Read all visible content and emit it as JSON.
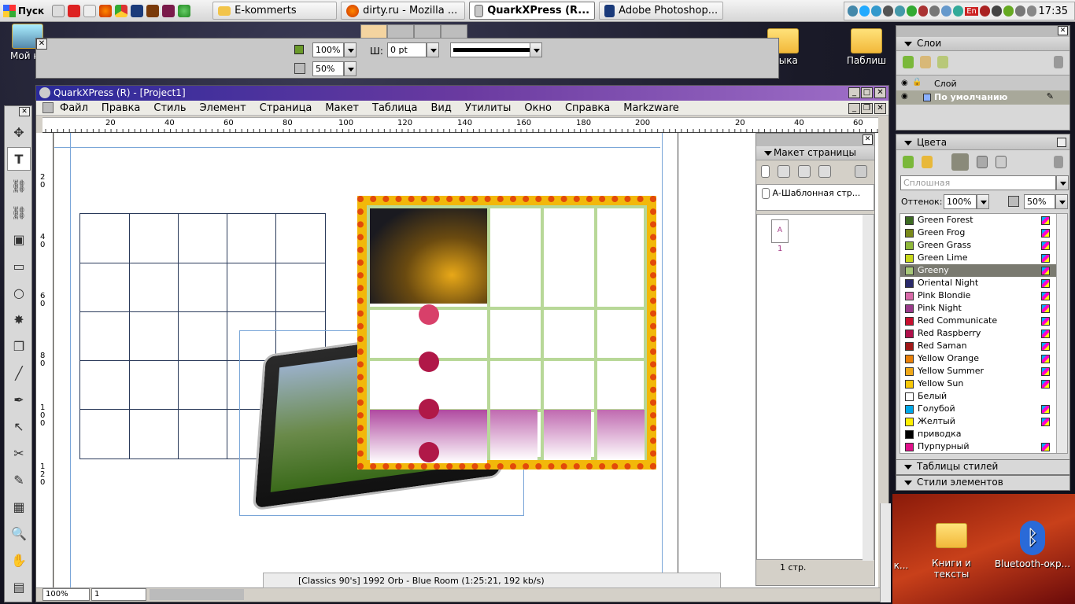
{
  "taskbar": {
    "start_label": "Пуск",
    "tasks": [
      {
        "label": "E-kommerts"
      },
      {
        "label": "dirty.ru - Mozilla ..."
      },
      {
        "label": "QuarkXPress (R..."
      },
      {
        "label": "Adobe Photoshop..."
      }
    ],
    "clock": "17:35",
    "lang": "En"
  },
  "desktop": {
    "icons": [
      {
        "label": "Мой ко"
      },
      {
        "label": "языка"
      },
      {
        "label": "Паблиш"
      },
      {
        "label": "Книги и тексты"
      },
      {
        "label": "Bluetooth-окр..."
      }
    ],
    "partial_label": "к..."
  },
  "measure": {
    "shade": "100%",
    "opacity": "50%",
    "width_label": "Ш:",
    "width_value": "0 pt"
  },
  "window": {
    "title": "QuarkXPress (R) - [Project1]",
    "menu": [
      "Файл",
      "Правка",
      "Стиль",
      "Элемент",
      "Страница",
      "Макет",
      "Таблица",
      "Вид",
      "Утилиты",
      "Окно",
      "Справка",
      "Markzware"
    ],
    "hruler_labels": [
      "20",
      "40",
      "60",
      "80",
      "100",
      "120",
      "140",
      "160",
      "180",
      "200",
      "20",
      "40",
      "60"
    ],
    "vruler_labels": [
      "2\n0",
      "4\n0",
      "6\n0",
      "8\n0",
      "1\n0\n0",
      "1\n2\n0"
    ],
    "zoom": "100%",
    "page_field": "1",
    "media_text": "[Classics 90's] 1992 Orb - Blue Room (1:25:21, 192 kb/s)"
  },
  "page_layout": {
    "title": "Макет страницы",
    "master_label": "А-Шаблонная стр...",
    "page_letter": "A",
    "page_num": "1",
    "page_count": "1 стр."
  },
  "layers": {
    "title": "Слои",
    "col_label": "Слой",
    "default_layer": "По умолчанию"
  },
  "colors": {
    "title": "Цвета",
    "fill_type": "Сплошная",
    "shade_label": "Оттенок:",
    "shade_value": "100%",
    "opacity_value": "50%",
    "list": [
      {
        "name": "Green Forest",
        "hex": "#3d6b22",
        "cmyk": true
      },
      {
        "name": "Green Frog",
        "hex": "#7a8a1a",
        "cmyk": true
      },
      {
        "name": "Green Grass",
        "hex": "#8fb83a",
        "cmyk": true
      },
      {
        "name": "Green Lime",
        "hex": "#c8d81a",
        "cmyk": true
      },
      {
        "name": "Greeny",
        "hex": "#a8c878",
        "cmyk": true,
        "selected": true
      },
      {
        "name": "Oriental Night",
        "hex": "#2a2a6a",
        "cmyk": true
      },
      {
        "name": "Pink Blondie",
        "hex": "#d86aa8",
        "cmyk": true
      },
      {
        "name": "Pink Night",
        "hex": "#9a3a8a",
        "cmyk": true
      },
      {
        "name": "Red Communicate",
        "hex": "#c8102e",
        "cmyk": true
      },
      {
        "name": "Red Raspberry",
        "hex": "#b0104a",
        "cmyk": true
      },
      {
        "name": "Red Saman",
        "hex": "#a01818",
        "cmyk": true
      },
      {
        "name": "Yellow Orange",
        "hex": "#e8800a",
        "cmyk": true
      },
      {
        "name": "Yellow Summer",
        "hex": "#f0a818",
        "cmyk": true
      },
      {
        "name": "Yellow Sun",
        "hex": "#f8c808",
        "cmyk": true
      },
      {
        "name": "Белый",
        "hex": "#ffffff",
        "cmyk": false
      },
      {
        "name": "Голубой",
        "hex": "#00a8e8",
        "cmyk": true
      },
      {
        "name": "Желтый",
        "hex": "#fff000",
        "cmyk": true
      },
      {
        "name": "приводка",
        "hex": "#000000",
        "cmyk": false
      },
      {
        "name": "Пурпурный",
        "hex": "#e0108a",
        "cmyk": true
      }
    ]
  },
  "collapsed": {
    "style_sheets": "Таблицы стилей",
    "item_styles": "Стили элементов"
  }
}
